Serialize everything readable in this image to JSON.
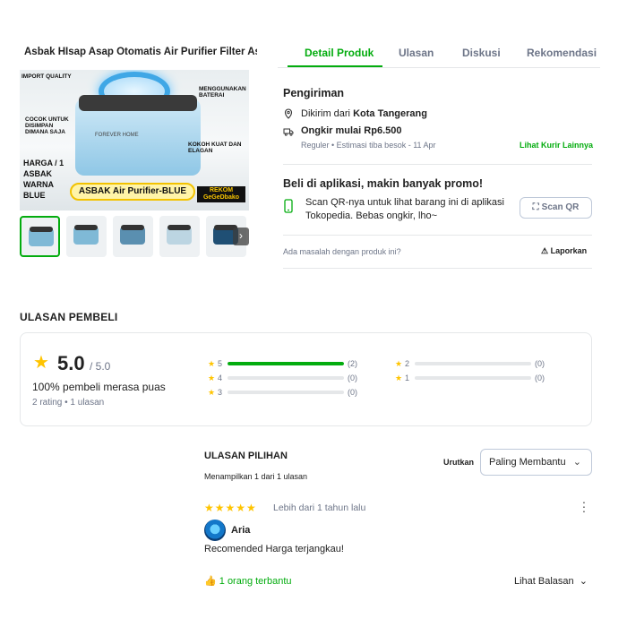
{
  "header": {
    "product_title": "Asbak HIsap Asap Otomatis Air Purifier Filter As...",
    "tabs": [
      "Detail Produk",
      "Ulasan",
      "Diskusi",
      "Rekomendasi"
    ]
  },
  "gallery": {
    "main_image": {
      "labels": [
        "IMPORT QUALITY",
        "MENGGUNAKAN BATERAI",
        "COCOK UNTUK DISIMPAN DIMANA SAJA",
        "KOKOH KUAT DAN ELAGAN"
      ],
      "brand": "FOREVER HOME",
      "price_badge": "HARGA / 1 ASBAK WARNA BLUE",
      "title_pill": "ASBAK Air Purifier-BLUE",
      "rekom": "REKOM GeGeDbako"
    },
    "thumb_count": 5,
    "next_icon": "chevron-right-icon"
  },
  "shipping": {
    "title": "Pengiriman",
    "from_prefix": "Dikirim dari ",
    "from_city": "Kota Tangerang",
    "ongkir": "Ongkir mulai Rp6.500",
    "estimate": "Reguler • Estimasi tiba besok - 11 Apr",
    "more_link": "Lihat Kurir Lainnya"
  },
  "app_promo": {
    "title": "Beli di aplikasi, makin banyak promo!",
    "text_line1": "Scan QR-nya untuk lihat barang ini di aplikasi",
    "text_line2": "Tokopedia. Bebas ongkir, lho~",
    "scan_button": "Scan QR"
  },
  "report": {
    "question": "Ada masalah dengan produk ini?",
    "link": "Laporkan"
  },
  "reviews": {
    "section_title": "ULASAN PEMBELI",
    "score": "5.0",
    "out_of": "/ 5.0",
    "satisfaction": "100% pembeli merasa puas",
    "summary": "2 rating • 1 ulasan",
    "distribution": [
      {
        "star": "5",
        "count": "(2)",
        "fraction": 1.0
      },
      {
        "star": "4",
        "count": "(0)",
        "fraction": 0
      },
      {
        "star": "3",
        "count": "(0)",
        "fraction": 0
      },
      {
        "star": "2",
        "count": "(0)",
        "fraction": 0
      },
      {
        "star": "1",
        "count": "(0)",
        "fraction": 0
      }
    ],
    "featured_title": "ULASAN PILIHAN",
    "showing": "Menampilkan 1 dari 1 ulasan",
    "sort_label": "Urutkan",
    "sort_value": "Paling Membantu",
    "item": {
      "stars": 5,
      "time": "Lebih dari 1 tahun lalu",
      "user": "Aria",
      "text": "Recomended Harga terjangkau!",
      "helpful": "1 orang terbantu",
      "reply_link": "Lihat Balasan"
    }
  },
  "colors": {
    "accent": "#03ac0e",
    "star": "#ffc400",
    "muted": "#6d7588"
  }
}
